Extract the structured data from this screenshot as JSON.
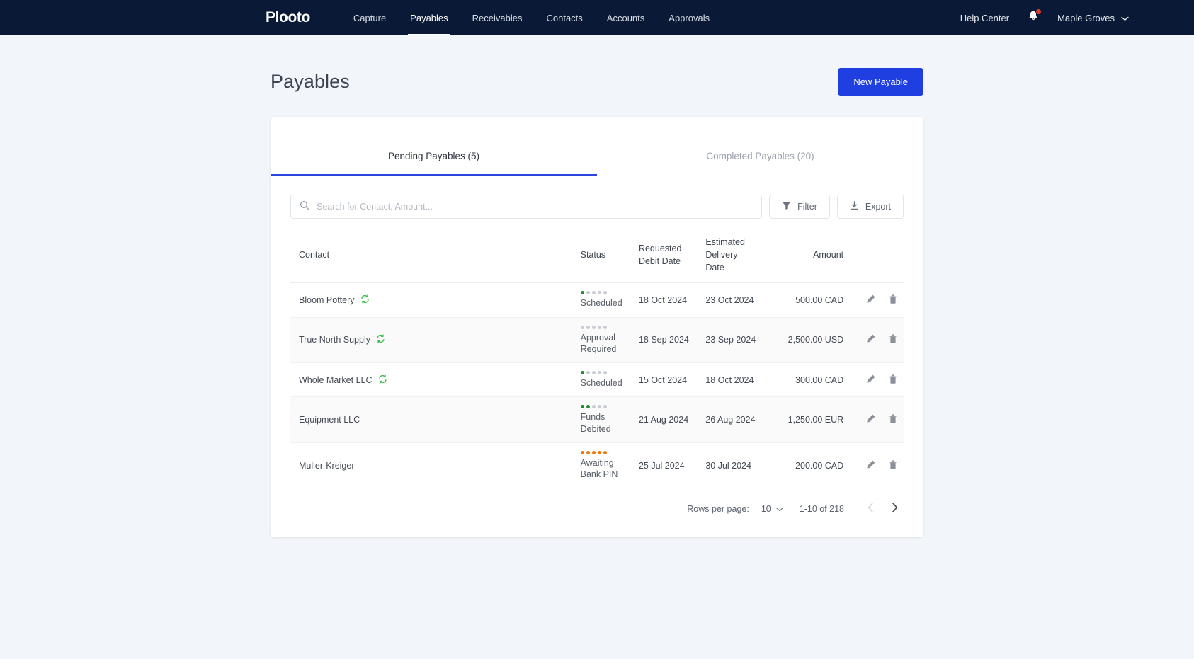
{
  "nav": {
    "brand": "Plooto",
    "items": [
      {
        "label": "Capture",
        "active": false
      },
      {
        "label": "Payables",
        "active": true
      },
      {
        "label": "Receivables",
        "active": false
      },
      {
        "label": "Contacts",
        "active": false
      },
      {
        "label": "Accounts",
        "active": false
      },
      {
        "label": "Approvals",
        "active": false
      }
    ],
    "help_center": "Help Center",
    "notifications_icon": "bell-icon",
    "has_notification_dot": true,
    "user": "Maple Groves",
    "user_chevron_icon": "chevron-down-icon"
  },
  "header": {
    "title": "Payables",
    "new_payable_label": "New Payable"
  },
  "tabs": [
    {
      "label": "Pending Payables (5)",
      "active": true
    },
    {
      "label": "Completed Payables (20)",
      "active": false
    }
  ],
  "toolbar": {
    "search_placeholder": "Search for Contact, Amount...",
    "search_value": "",
    "search_icon": "search-icon",
    "filter_label": "Filter",
    "filter_icon": "funnel-icon",
    "export_label": "Export",
    "export_icon": "download-icon"
  },
  "table": {
    "headers": {
      "contact": "Contact",
      "status": "Status",
      "requested_debit_date": [
        "Requested",
        "Debit Date"
      ],
      "estimated_delivery_date": [
        "Estimated",
        "Delivery",
        "Date"
      ],
      "amount": "Amount"
    },
    "rows": [
      {
        "contact": "Bloom Pottery",
        "recurring": true,
        "status_label": [
          "Scheduled"
        ],
        "status_filled": 1,
        "status_total": 5,
        "status_color": "green",
        "requested_debit_date": "18 Oct 2024",
        "estimated_delivery_date": "23 Oct 2024",
        "amount": "500.00 CAD"
      },
      {
        "contact": "True North Supply",
        "recurring": true,
        "status_label": [
          "Approval",
          "Required"
        ],
        "status_filled": 0,
        "status_total": 5,
        "status_color": "gray",
        "requested_debit_date": "18 Sep 2024",
        "estimated_delivery_date": "23 Sep 2024",
        "amount": "2,500.00 USD"
      },
      {
        "contact": "Whole Market LLC",
        "recurring": true,
        "status_label": [
          "Scheduled"
        ],
        "status_filled": 1,
        "status_total": 5,
        "status_color": "green",
        "requested_debit_date": "15 Oct 2024",
        "estimated_delivery_date": "18 Oct 2024",
        "amount": "300.00 CAD"
      },
      {
        "contact": "Equipment LLC",
        "recurring": false,
        "status_label": [
          "Funds",
          "Debited"
        ],
        "status_filled": 2,
        "status_total": 5,
        "status_color": "green",
        "requested_debit_date": "21 Aug 2024",
        "estimated_delivery_date": "26 Aug 2024",
        "amount": "1,250.00 EUR"
      },
      {
        "contact": "Muller-Kreiger",
        "recurring": false,
        "status_label": [
          "Awaiting",
          "Bank PIN"
        ],
        "status_filled": 5,
        "status_total": 5,
        "status_color": "orange",
        "requested_debit_date": "25 Jul 2024",
        "estimated_delivery_date": "30 Jul 2024",
        "amount": "200.00 CAD"
      }
    ],
    "row_actions": {
      "edit_icon": "pencil-icon",
      "delete_icon": "trash-icon"
    }
  },
  "pagination": {
    "rows_per_page_label": "Rows per page:",
    "rows_per_page_value": "10",
    "range_label": "1-10 of 218",
    "prev_icon": "chevron-left-icon",
    "next_icon": "chevron-right-icon",
    "prev_enabled": false,
    "next_enabled": true
  },
  "colors": {
    "nav_bg": "#0a1a36",
    "page_bg": "#f2f5f9",
    "accent_blue": "#1f3fe0",
    "tab_underline": "#2d45e0",
    "status_green": "#1f8a30",
    "status_orange": "#ee7913",
    "status_gray": "#c9ccd2",
    "notification_red": "#e23b26",
    "recurring_green": "#3bbf4a"
  }
}
